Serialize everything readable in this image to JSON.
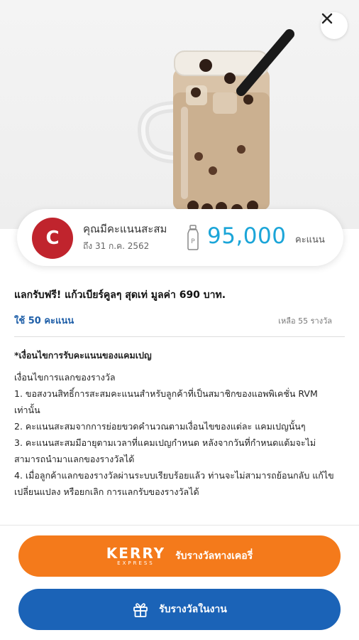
{
  "header": {
    "close_icon": "close-icon"
  },
  "points": {
    "avatar_letter": "C",
    "title": "คุณมีคะแนนสะสม",
    "expiry": "ถึง 31 ก.ค. 2562",
    "value": "95,000",
    "unit": "คะแนน",
    "icon": "bottle-icon",
    "accent_color": "#1ba5d8",
    "avatar_color": "#c0242d"
  },
  "reward": {
    "title": "แลกรับฟรี! แก้วเบียร์คูลๆ สุดเท่ มูลค่า 690 บาท.",
    "use_points": "ใช้ 50 คะแนน",
    "remaining": "เหลือ   55 รางวัล"
  },
  "terms": {
    "heading": "*เงื่อนไขการรับคะแนนของแคมเปญ",
    "lines": [
      "เงื่อนไขการแลกของรางวัล",
      "1. ขอสงวนสิทธิ์การสะสมคะแนนสำหรับลูกค้าที่เป็นสมาชิกของแอพพิเคชั่น RVM เท่านั้น",
      "2. คะแนนสะสมจากการย่อยขวดคำนวณตามเงื่อนไขของแต่ละ แคมเปญนั้นๆ",
      "3. คะแนนสะสมมีอายุตามเวลาที่แคมเปญกำหนด หลังจากวันที่กำหนดแต้มจะไม่สามารถนำมาแลกของรางวัลได้",
      "4. เมื่อลูกค้าแลกของรางวัลผ่านระบบเรียบร้อยแล้ว ท่านจะไม่สามารถย้อนกลับ แก้ไข เปลี่ยนแปลง หรือยกเลิก การแลกรับของรางวัลได้"
    ]
  },
  "actions": {
    "kerry_logo_text": "KERRY",
    "kerry_logo_sub": "EXPRESS",
    "kerry_label": "รับรางวัลทางเคอรี่",
    "kerry_color": "#f47a1b",
    "event_label": "รับรางวัลในงาน",
    "event_icon": "gift-icon",
    "event_color": "#1b63b7"
  }
}
